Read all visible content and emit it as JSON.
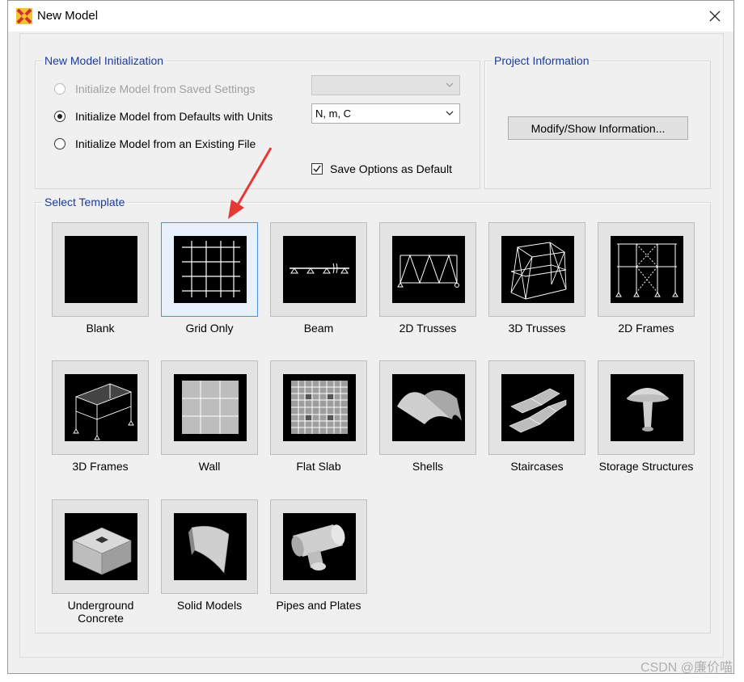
{
  "window": {
    "title": "New Model"
  },
  "init": {
    "legend": "New Model Initialization",
    "options": [
      {
        "label": "Initialize Model from Saved Settings",
        "selected": false,
        "disabled": true
      },
      {
        "label": "Initialize Model from Defaults with Units",
        "selected": true,
        "disabled": false
      },
      {
        "label": "Initialize Model from an Existing File",
        "selected": false,
        "disabled": false
      }
    ],
    "saved_settings_value": "",
    "units_value": "N, m, C",
    "save_default_label": "Save Options as Default",
    "save_default_checked": true
  },
  "project": {
    "legend": "Project Information",
    "button_label": "Modify/Show Information..."
  },
  "templates": {
    "legend": "Select Template",
    "selected": "Grid Only",
    "items": [
      {
        "label": "Blank"
      },
      {
        "label": "Grid Only"
      },
      {
        "label": "Beam"
      },
      {
        "label": "2D Trusses"
      },
      {
        "label": "3D Trusses"
      },
      {
        "label": "2D Frames"
      },
      {
        "label": "3D Frames"
      },
      {
        "label": "Wall"
      },
      {
        "label": "Flat Slab"
      },
      {
        "label": "Shells"
      },
      {
        "label": "Staircases"
      },
      {
        "label": "Storage Structures"
      },
      {
        "label": "Underground Concrete"
      },
      {
        "label": "Solid Models"
      },
      {
        "label": "Pipes and Plates"
      }
    ]
  },
  "watermark": "CSDN @廉价喵",
  "colors": {
    "legend_text": "#1a3a9c",
    "annotation_arrow": "#e53935",
    "selection_border": "#4a90d9"
  }
}
